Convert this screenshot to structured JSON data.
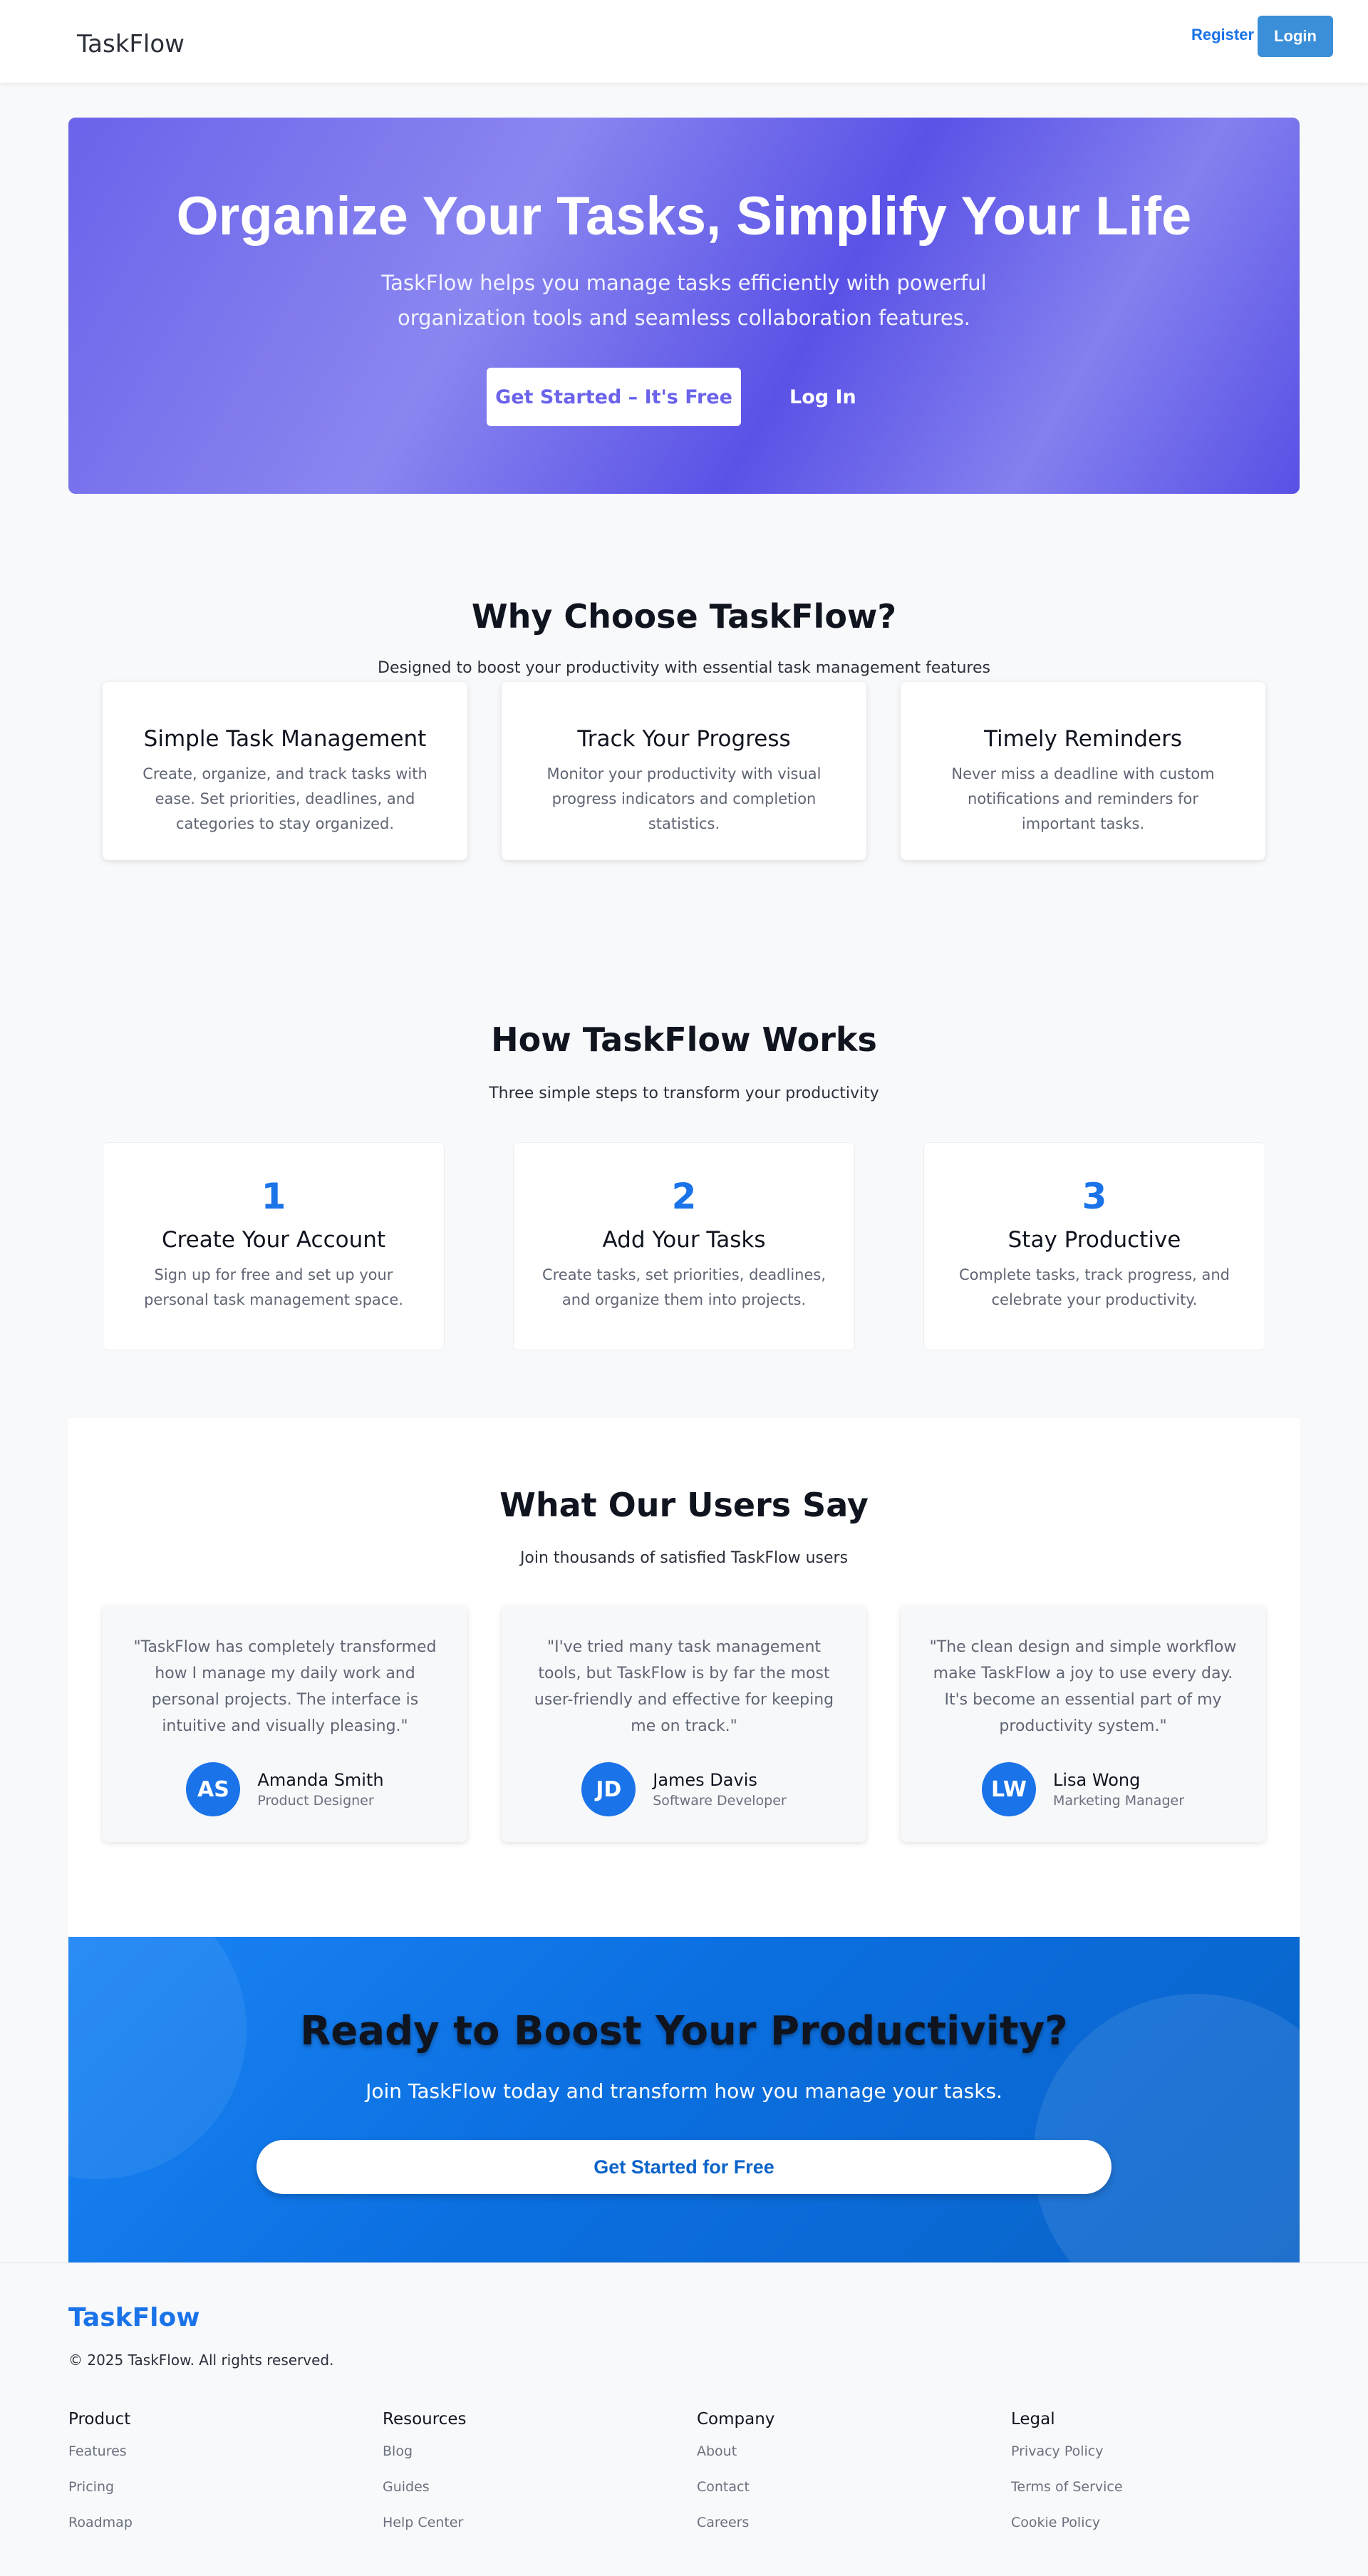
{
  "nav": {
    "brand": "TaskFlow",
    "register_label": "Register",
    "login_label": "Login"
  },
  "hero": {
    "title": "Organize Your Tasks, Simplify Your Life",
    "subtitle_line1": "TaskFlow helps you manage tasks efficiently with powerful",
    "subtitle_line2": "organization tools and seamless collaboration features.",
    "cta_label": "Get Started – It's Free",
    "login_label": "Log In"
  },
  "features": {
    "title": "Why Choose TaskFlow?",
    "subtitle": "Designed to boost your productivity with essential task management features",
    "cards": [
      {
        "title": "Simple Task Management",
        "text": "Create, organize, and track tasks with ease. Set priorities, deadlines, and categories to stay organized."
      },
      {
        "title": "Track Your Progress",
        "text": "Monitor your productivity with visual progress indicators and completion statistics."
      },
      {
        "title": "Timely Reminders",
        "text": "Never miss a deadline with custom notifications and reminders for important tasks."
      }
    ]
  },
  "steps": {
    "title": "How TaskFlow Works",
    "subtitle": "Three simple steps to transform your productivity",
    "cards": [
      {
        "number": "1",
        "title": "Create Your Account",
        "text": "Sign up for free and set up your personal task management space."
      },
      {
        "number": "2",
        "title": "Add Your Tasks",
        "text": "Create tasks, set priorities, deadlines, and organize them into projects."
      },
      {
        "number": "3",
        "title": "Stay Productive",
        "text": "Complete tasks, track progress, and celebrate your productivity."
      }
    ]
  },
  "testimonials": {
    "title": "What Our Users Say",
    "subtitle": "Join thousands of satisfied TaskFlow users",
    "cards": [
      {
        "quote": "\"TaskFlow has completely transformed how I manage my daily work and personal projects. The interface is intuitive and visually pleasing.\"",
        "initials": "AS",
        "name": "Amanda Smith",
        "role": "Product Designer"
      },
      {
        "quote": "\"I've tried many task management tools, but TaskFlow is by far the most user-friendly and effective for keeping me on track.\"",
        "initials": "JD",
        "name": "James Davis",
        "role": "Software Developer"
      },
      {
        "quote": "\"The clean design and simple workflow make TaskFlow a joy to use every day. It's become an essential part of my productivity system.\"",
        "initials": "LW",
        "name": "Lisa Wong",
        "role": "Marketing Manager"
      }
    ]
  },
  "cta": {
    "title": "Ready to Boost Your Productivity?",
    "subtitle": "Join TaskFlow today and transform how you manage your tasks.",
    "button_label": "Get Started for Free"
  },
  "footer": {
    "brand": "TaskFlow",
    "copyright": "© 2025 TaskFlow. All rights reserved.",
    "columns": [
      {
        "title": "Product",
        "links": [
          "Features",
          "Pricing",
          "Roadmap"
        ]
      },
      {
        "title": "Resources",
        "links": [
          "Blog",
          "Guides",
          "Help Center"
        ]
      },
      {
        "title": "Company",
        "links": [
          "About",
          "Contact",
          "Careers"
        ]
      },
      {
        "title": "Legal",
        "links": [
          "Privacy Policy",
          "Terms of Service",
          "Cookie Policy"
        ]
      }
    ]
  },
  "colors": {
    "accent": "#1a73e8",
    "hero_purple": "#6b63ea",
    "login_button": "#3b8fd9",
    "cta_blue": "#0b6fe0"
  }
}
